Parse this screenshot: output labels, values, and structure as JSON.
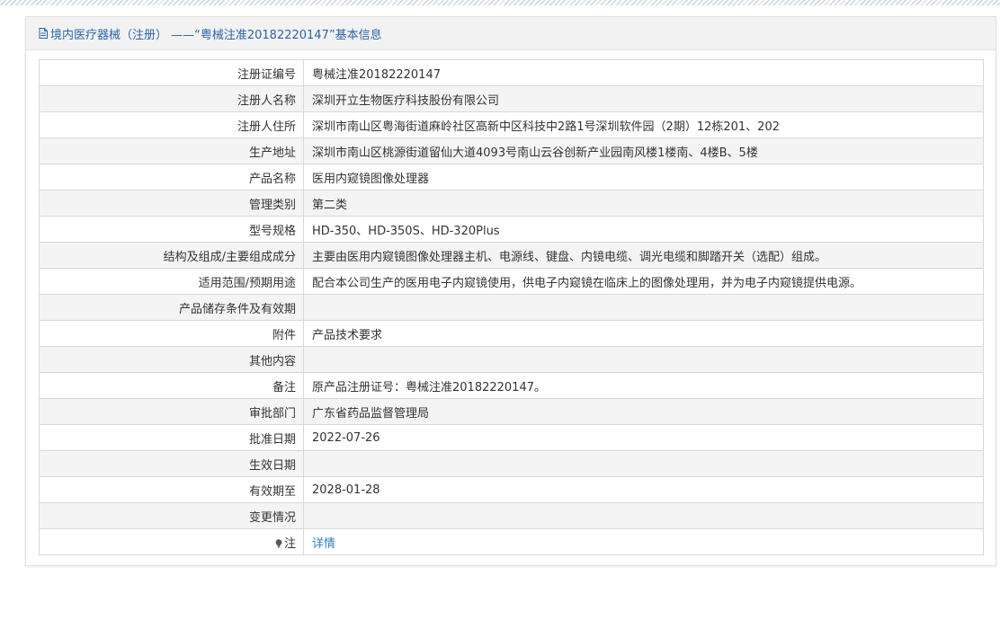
{
  "header": {
    "title": "境内医疗器械（注册） ——“粤械注准20182220147”基本信息"
  },
  "rows": [
    {
      "label": "注册证编号",
      "value": "粤械注准20182220147"
    },
    {
      "label": "注册人名称",
      "value": "深圳开立生物医疗科技股份有限公司"
    },
    {
      "label": "注册人住所",
      "value": "深圳市南山区粤海街道麻岭社区高新中区科技中2路1号深圳软件园（2期）12栋201、202"
    },
    {
      "label": "生产地址",
      "value": "深圳市南山区桃源街道留仙大道4093号南山云谷创新产业园南风楼1楼南、4楼B、5楼"
    },
    {
      "label": "产品名称",
      "value": "医用内窥镜图像处理器"
    },
    {
      "label": "管理类别",
      "value": "第二类"
    },
    {
      "label": "型号规格",
      "value": "HD-350、HD-350S、HD-320Plus"
    },
    {
      "label": "结构及组成/主要组成成分",
      "value": "主要由医用内窥镜图像处理器主机、电源线、键盘、内镜电缆、调光电缆和脚踏开关（选配）组成。"
    },
    {
      "label": "适用范围/预期用途",
      "value": "配合本公司生产的医用电子内窥镜使用，供电子内窥镜在临床上的图像处理用，并为电子内窥镜提供电源。"
    },
    {
      "label": "产品储存条件及有效期",
      "value": ""
    },
    {
      "label": "附件",
      "value": "产品技术要求"
    },
    {
      "label": "其他内容",
      "value": ""
    },
    {
      "label": "备注",
      "value": "原产品注册证号：粤械注准20182220147。"
    },
    {
      "label": "审批部门",
      "value": "广东省药品监督管理局"
    },
    {
      "label": "批准日期",
      "value": "2022-07-26"
    },
    {
      "label": "生效日期",
      "value": ""
    },
    {
      "label": "有效期至",
      "value": "2028-01-28"
    },
    {
      "label": "变更情况",
      "value": ""
    }
  ],
  "note_row": {
    "label": "注",
    "icon": "lightbulb-icon",
    "link_text": "详情"
  },
  "colors": {
    "header_text": "#2a64a8",
    "link": "#2f7dc6",
    "row_alt": "#f4f4f4",
    "border": "#d8d8d8"
  }
}
